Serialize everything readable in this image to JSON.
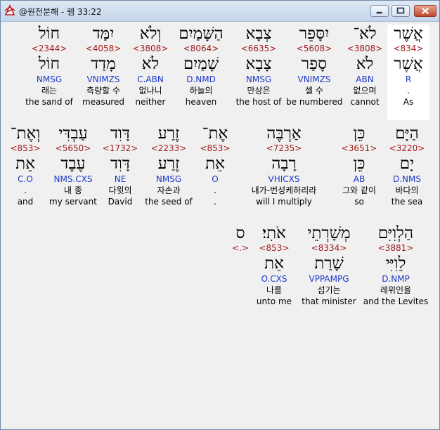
{
  "window": {
    "title": "@원전분해 - 렘 33:22",
    "controls": {
      "minimize": "minimize",
      "maximize": "maximize",
      "close": "close"
    }
  },
  "rows": [
    {
      "words": [
        {
          "heb": "אֲשֶׁר",
          "strong": "<834>",
          "root": "אֲשֶׁר",
          "parse": "R",
          "kor": ".",
          "eng": "As",
          "highlight": true
        },
        {
          "heb": "לֹא־",
          "strong": "<3808>",
          "root": "לֹא",
          "parse": "ABN",
          "kor": "없으며",
          "eng": "cannot"
        },
        {
          "heb": "יִסָּפֵר",
          "strong": "<5608>",
          "root": "סָפַר",
          "parse": "VNIMZS",
          "kor": "셀 수",
          "eng": "be numbered"
        },
        {
          "heb": "צְבָא",
          "strong": "<6635>",
          "root": "צָבָא",
          "parse": "NMSG",
          "kor": "만상은",
          "eng": "the host of"
        },
        {
          "heb": "הַשָּׁמַיִם",
          "strong": "<8064>",
          "root": "שָׁמַיִם",
          "parse": "D.NMD",
          "kor": "하늘의",
          "eng": "heaven"
        },
        {
          "heb": "וְלֹא",
          "strong": "<3808>",
          "root": "לֹא",
          "parse": "C.ABN",
          "kor": "없나니",
          "eng": "neither"
        },
        {
          "heb": "יִמַּד",
          "strong": "<4058>",
          "root": "מָדַד",
          "parse": "VNIMZS",
          "kor": "측량할 수",
          "eng": "measured"
        },
        {
          "heb": "חוֹל",
          "strong": "<2344>",
          "root": "חוֹל",
          "parse": "NMSG",
          "kor": "래는",
          "eng": "the sand of"
        }
      ]
    },
    {
      "words": [
        {
          "heb": "הַיָּם",
          "strong": "<3220>",
          "root": "יָם",
          "parse": "D.NMS",
          "kor": "바다의",
          "eng": "the sea"
        },
        {
          "heb": "כֵּן",
          "strong": "<3651>",
          "root": "כֵּן",
          "parse": "AB",
          "kor": "그와 같이",
          "eng": "so"
        },
        {
          "heb": "אַרְבֶּה",
          "strong": "<7235>",
          "root": "רָבָה",
          "parse": "VHICXS",
          "kor": "내가-번성케하리라",
          "eng": "will I multiply"
        },
        {
          "heb": "אֶת־",
          "strong": "<853>",
          "root": "אֵת",
          "parse": "O",
          "kor": ".",
          "eng": "."
        },
        {
          "heb": "זֶרַע",
          "strong": "<2233>",
          "root": "זֶרַע",
          "parse": "NMSG",
          "kor": "자손과",
          "eng": "the seed of"
        },
        {
          "heb": "דָּוִד",
          "strong": "<1732>",
          "root": "דָּוִד",
          "parse": "NE",
          "kor": "다윗의",
          "eng": "David"
        },
        {
          "heb": "עַבְדִּי",
          "strong": "<5650>",
          "root": "עֶבֶד",
          "parse": "NMS.CXS",
          "kor": "내 종",
          "eng": "my servant"
        },
        {
          "heb": "וְאֶת־",
          "strong": "<853>",
          "root": "אֵת",
          "parse": "C.O",
          "kor": ".",
          "eng": "and"
        }
      ]
    },
    {
      "words": [
        {
          "heb": "הַלְוִיִּם",
          "strong": "<3881>",
          "root": "לֵוִיִּי",
          "parse": "D.NMP",
          "kor": "레위인을",
          "eng": "and the Levites"
        },
        {
          "heb": "מְשָׁרְתֵי",
          "strong": "<8334>",
          "root": "שָׁרַת",
          "parse": "VPPAMPG",
          "kor": "섬기는",
          "eng": "that minister"
        },
        {
          "heb": "אֹתִי׃",
          "strong": "<853>",
          "root": "אֵת",
          "parse": "O.CXS",
          "kor": "나를",
          "eng": "unto me"
        },
        {
          "heb": "ס",
          "strong": "<.>",
          "root": "",
          "parse": "",
          "kor": "",
          "eng": ""
        }
      ]
    }
  ]
}
